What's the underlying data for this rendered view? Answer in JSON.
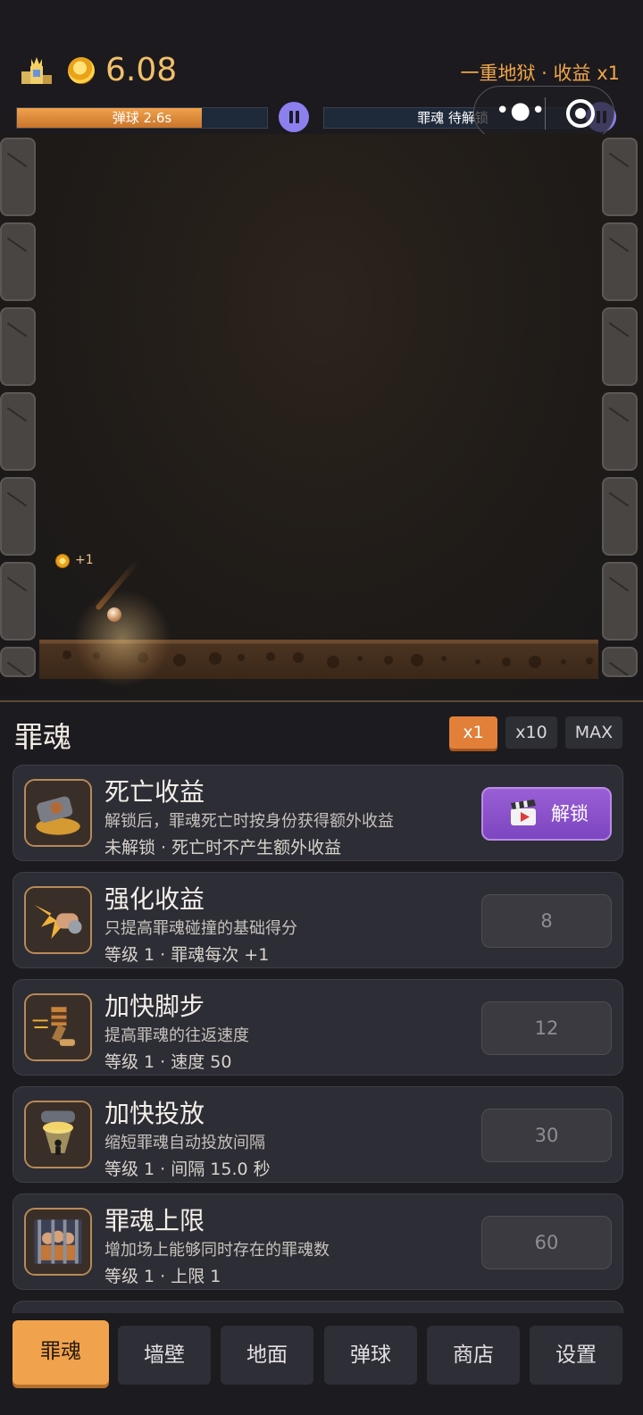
{
  "hud": {
    "coins": "6.08",
    "level_label": "一重地狱 · 收益 x1",
    "ball_timer": "弹球 2.6s",
    "ball_progress": 0.74,
    "soul_timer": "罪魂 待解锁",
    "soul_progress": 0
  },
  "arena": {
    "coin_popup": "+1"
  },
  "panel": {
    "title": "罪魂",
    "multipliers": [
      "x1",
      "x10",
      "MAX"
    ],
    "active_multiplier": "x1"
  },
  "upgrades": [
    {
      "name": "死亡收益",
      "desc": "解锁后，罪魂死亡时按身份获得额外收益",
      "stat": "未解锁 · 死亡时不产生额外收益",
      "button": "解锁",
      "icon": "coffin-gold-icon"
    },
    {
      "name": "强化收益",
      "desc": "只提高罪魂碰撞的基础得分",
      "stat": "等级 1 · 罪魂每次 +1",
      "button": "8",
      "icon": "fist-impact-icon"
    },
    {
      "name": "加快脚步",
      "desc": "提高罪魂的往返速度",
      "stat": "等级 1 · 速度 50",
      "button": "12",
      "icon": "running-legs-icon"
    },
    {
      "name": "加快投放",
      "desc": "缩短罪魂自动投放间隔",
      "stat": "等级 1 · 间隔 15.0 秒",
      "button": "30",
      "icon": "dropper-portal-icon"
    },
    {
      "name": "罪魂上限",
      "desc": "增加场上能够同时存在的罪魂数",
      "stat": "等级 1 · 上限 1",
      "button": "60",
      "icon": "prison-cell-icon"
    }
  ],
  "tabs": [
    "罪魂",
    "墙壁",
    "地面",
    "弹球",
    "商店",
    "设置"
  ],
  "active_tab": "罪魂",
  "colors": {
    "accent": "#f0a34c",
    "unlock": "#8a52cc",
    "pause": "#8b80ee"
  }
}
